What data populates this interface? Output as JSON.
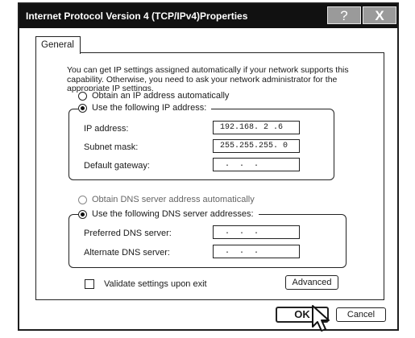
{
  "window": {
    "title": "Internet Protocol Version 4 (TCP/IPv4)Properties",
    "help_label": "?",
    "close_label": "X"
  },
  "tabs": [
    {
      "label": "General",
      "selected": true
    }
  ],
  "general": {
    "intro_text": "You can get IP settings assigned automatically if your network supports this capability. Otherwise, you need to ask your network administrator for the appropriate IP settings.",
    "ip_auto": {
      "label": "Obtain an IP address automatically",
      "selected": false
    },
    "ip_manual": {
      "label": "Use the following IP address:",
      "selected": true
    },
    "ip_fields": [
      {
        "label": "IP address:",
        "value": "192.168. 2 .6"
      },
      {
        "label": "Subnet mask:",
        "value": "255.255.255. 0"
      },
      {
        "label": "Default gateway:",
        "value": " .  .  . "
      }
    ],
    "dns_auto": {
      "label": "Obtain DNS  server address automatically",
      "selected": false,
      "enabled": false
    },
    "dns_manual": {
      "label": "Use the following DNS server addresses:",
      "selected": true
    },
    "dns_fields": [
      {
        "label": "Preferred DNS server:",
        "value": " .  .  . "
      },
      {
        "label": "Alternate DNS server:",
        "value": " .  .  . "
      }
    ],
    "validate": {
      "label": "Validate settings upon exit",
      "checked": false
    },
    "advanced_label": "Advanced"
  },
  "footer": {
    "ok_label": "OK",
    "cancel_label": "Cancel"
  },
  "colors": {
    "titlebar": "#111111",
    "titlebar_button": "#9a9a9a",
    "border": "#222222"
  }
}
